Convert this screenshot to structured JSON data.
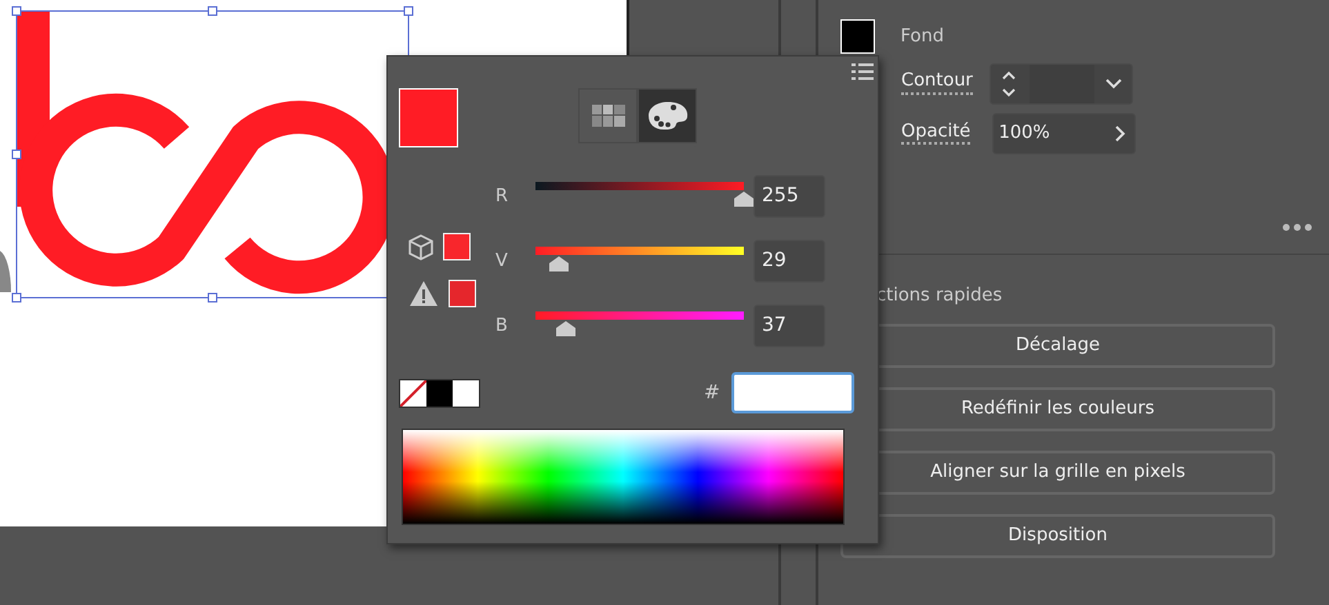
{
  "color_picker": {
    "modes": [
      {
        "kind": "swatches",
        "selected": false
      },
      {
        "kind": "palette",
        "selected": true
      }
    ],
    "sliders": [
      {
        "label": "R",
        "level": 1,
        "value": "255",
        "kind": "red"
      },
      {
        "label": "V",
        "level": 0.114,
        "value": "29",
        "kind": "green"
      },
      {
        "label": "B",
        "level": 0.145,
        "value": "37",
        "kind": "blue"
      }
    ],
    "hex": {
      "label": "#"
    }
  },
  "properties": {
    "fill": {
      "label": "Fond"
    },
    "stroke": {
      "label": "Contour"
    },
    "opacity": {
      "label": "Opacité",
      "value": "100%"
    }
  },
  "quick_actions": {
    "title": "ctions rapides",
    "buttons": [
      "Décalage",
      "Redéfinir les couleurs",
      "Aligner sur la grille en pixels",
      "Disposition"
    ]
  }
}
